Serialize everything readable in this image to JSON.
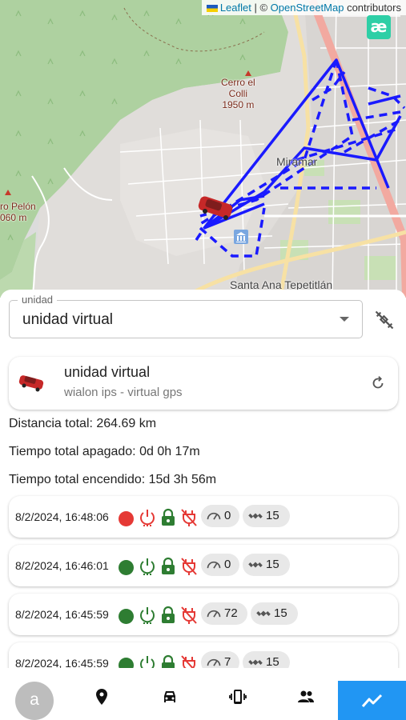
{
  "map": {
    "attribution_leaflet": "Leaflet",
    "attribution_sep": " | © ",
    "attribution_osm": "OpenStreetMap",
    "attribution_suffix": " contributors",
    "logo_text": "æ",
    "labels": {
      "cerro_name1": "Cerro el",
      "cerro_name2": "Colli",
      "cerro_elev": "1950 m",
      "pelon_name": "ro Pelón",
      "pelon_elev": "060 m",
      "miramar": "Miramar",
      "santa_ana": "Santa Ana Tepetitlán"
    },
    "route_color": "#1a1aff"
  },
  "selector": {
    "legend": "unidad",
    "value": "unidad virtual"
  },
  "unit": {
    "name": "unidad virtual",
    "subtitle": "wialon ips - virtual gps",
    "icon": "red-car-icon"
  },
  "stats": {
    "distance": "Distancia total: 264.69 km",
    "off_time": "Tiempo total apagado: 0d 0h 17m",
    "on_time": "Tiempo total encendido: 15d 3h 56m"
  },
  "colors": {
    "red": "#e53935",
    "green": "#2e7d32",
    "accent": "#2196f3"
  },
  "events": [
    {
      "time": "8/2/2024, 16:48:06",
      "status": "red",
      "speed": "0",
      "sats": "15"
    },
    {
      "time": "8/2/2024, 16:46:01",
      "status": "green",
      "speed": "0",
      "sats": "15"
    },
    {
      "time": "8/2/2024, 16:45:59",
      "status": "green",
      "speed": "72",
      "sats": "15"
    },
    {
      "time": "8/2/2024, 16:45:59",
      "status": "green",
      "speed": "7",
      "sats": "15"
    }
  ],
  "nav": {
    "avatar_letter": "a",
    "items": [
      "location-pin-icon",
      "car-icon",
      "vibrating-phone-icon",
      "group-icon",
      "trending-icon"
    ]
  }
}
